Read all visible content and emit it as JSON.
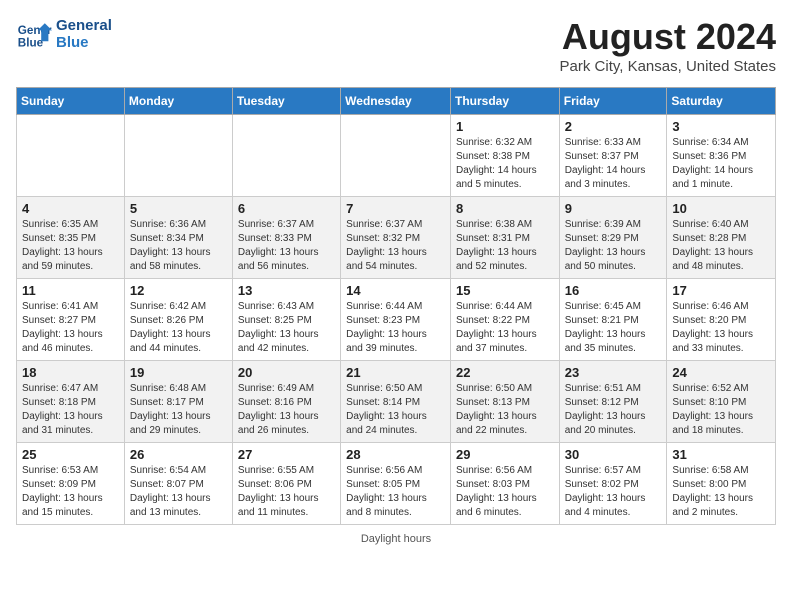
{
  "header": {
    "logo_line1": "General",
    "logo_line2": "Blue",
    "month_title": "August 2024",
    "location": "Park City, Kansas, United States"
  },
  "days_of_week": [
    "Sunday",
    "Monday",
    "Tuesday",
    "Wednesday",
    "Thursday",
    "Friday",
    "Saturday"
  ],
  "weeks": [
    [
      {
        "day": "",
        "sunrise": "",
        "sunset": "",
        "daylight": ""
      },
      {
        "day": "",
        "sunrise": "",
        "sunset": "",
        "daylight": ""
      },
      {
        "day": "",
        "sunrise": "",
        "sunset": "",
        "daylight": ""
      },
      {
        "day": "",
        "sunrise": "",
        "sunset": "",
        "daylight": ""
      },
      {
        "day": "1",
        "sunrise": "Sunrise: 6:32 AM",
        "sunset": "Sunset: 8:38 PM",
        "daylight": "Daylight: 14 hours and 5 minutes."
      },
      {
        "day": "2",
        "sunrise": "Sunrise: 6:33 AM",
        "sunset": "Sunset: 8:37 PM",
        "daylight": "Daylight: 14 hours and 3 minutes."
      },
      {
        "day": "3",
        "sunrise": "Sunrise: 6:34 AM",
        "sunset": "Sunset: 8:36 PM",
        "daylight": "Daylight: 14 hours and 1 minute."
      }
    ],
    [
      {
        "day": "4",
        "sunrise": "Sunrise: 6:35 AM",
        "sunset": "Sunset: 8:35 PM",
        "daylight": "Daylight: 13 hours and 59 minutes."
      },
      {
        "day": "5",
        "sunrise": "Sunrise: 6:36 AM",
        "sunset": "Sunset: 8:34 PM",
        "daylight": "Daylight: 13 hours and 58 minutes."
      },
      {
        "day": "6",
        "sunrise": "Sunrise: 6:37 AM",
        "sunset": "Sunset: 8:33 PM",
        "daylight": "Daylight: 13 hours and 56 minutes."
      },
      {
        "day": "7",
        "sunrise": "Sunrise: 6:37 AM",
        "sunset": "Sunset: 8:32 PM",
        "daylight": "Daylight: 13 hours and 54 minutes."
      },
      {
        "day": "8",
        "sunrise": "Sunrise: 6:38 AM",
        "sunset": "Sunset: 8:31 PM",
        "daylight": "Daylight: 13 hours and 52 minutes."
      },
      {
        "day": "9",
        "sunrise": "Sunrise: 6:39 AM",
        "sunset": "Sunset: 8:29 PM",
        "daylight": "Daylight: 13 hours and 50 minutes."
      },
      {
        "day": "10",
        "sunrise": "Sunrise: 6:40 AM",
        "sunset": "Sunset: 8:28 PM",
        "daylight": "Daylight: 13 hours and 48 minutes."
      }
    ],
    [
      {
        "day": "11",
        "sunrise": "Sunrise: 6:41 AM",
        "sunset": "Sunset: 8:27 PM",
        "daylight": "Daylight: 13 hours and 46 minutes."
      },
      {
        "day": "12",
        "sunrise": "Sunrise: 6:42 AM",
        "sunset": "Sunset: 8:26 PM",
        "daylight": "Daylight: 13 hours and 44 minutes."
      },
      {
        "day": "13",
        "sunrise": "Sunrise: 6:43 AM",
        "sunset": "Sunset: 8:25 PM",
        "daylight": "Daylight: 13 hours and 42 minutes."
      },
      {
        "day": "14",
        "sunrise": "Sunrise: 6:44 AM",
        "sunset": "Sunset: 8:23 PM",
        "daylight": "Daylight: 13 hours and 39 minutes."
      },
      {
        "day": "15",
        "sunrise": "Sunrise: 6:44 AM",
        "sunset": "Sunset: 8:22 PM",
        "daylight": "Daylight: 13 hours and 37 minutes."
      },
      {
        "day": "16",
        "sunrise": "Sunrise: 6:45 AM",
        "sunset": "Sunset: 8:21 PM",
        "daylight": "Daylight: 13 hours and 35 minutes."
      },
      {
        "day": "17",
        "sunrise": "Sunrise: 6:46 AM",
        "sunset": "Sunset: 8:20 PM",
        "daylight": "Daylight: 13 hours and 33 minutes."
      }
    ],
    [
      {
        "day": "18",
        "sunrise": "Sunrise: 6:47 AM",
        "sunset": "Sunset: 8:18 PM",
        "daylight": "Daylight: 13 hours and 31 minutes."
      },
      {
        "day": "19",
        "sunrise": "Sunrise: 6:48 AM",
        "sunset": "Sunset: 8:17 PM",
        "daylight": "Daylight: 13 hours and 29 minutes."
      },
      {
        "day": "20",
        "sunrise": "Sunrise: 6:49 AM",
        "sunset": "Sunset: 8:16 PM",
        "daylight": "Daylight: 13 hours and 26 minutes."
      },
      {
        "day": "21",
        "sunrise": "Sunrise: 6:50 AM",
        "sunset": "Sunset: 8:14 PM",
        "daylight": "Daylight: 13 hours and 24 minutes."
      },
      {
        "day": "22",
        "sunrise": "Sunrise: 6:50 AM",
        "sunset": "Sunset: 8:13 PM",
        "daylight": "Daylight: 13 hours and 22 minutes."
      },
      {
        "day": "23",
        "sunrise": "Sunrise: 6:51 AM",
        "sunset": "Sunset: 8:12 PM",
        "daylight": "Daylight: 13 hours and 20 minutes."
      },
      {
        "day": "24",
        "sunrise": "Sunrise: 6:52 AM",
        "sunset": "Sunset: 8:10 PM",
        "daylight": "Daylight: 13 hours and 18 minutes."
      }
    ],
    [
      {
        "day": "25",
        "sunrise": "Sunrise: 6:53 AM",
        "sunset": "Sunset: 8:09 PM",
        "daylight": "Daylight: 13 hours and 15 minutes."
      },
      {
        "day": "26",
        "sunrise": "Sunrise: 6:54 AM",
        "sunset": "Sunset: 8:07 PM",
        "daylight": "Daylight: 13 hours and 13 minutes."
      },
      {
        "day": "27",
        "sunrise": "Sunrise: 6:55 AM",
        "sunset": "Sunset: 8:06 PM",
        "daylight": "Daylight: 13 hours and 11 minutes."
      },
      {
        "day": "28",
        "sunrise": "Sunrise: 6:56 AM",
        "sunset": "Sunset: 8:05 PM",
        "daylight": "Daylight: 13 hours and 8 minutes."
      },
      {
        "day": "29",
        "sunrise": "Sunrise: 6:56 AM",
        "sunset": "Sunset: 8:03 PM",
        "daylight": "Daylight: 13 hours and 6 minutes."
      },
      {
        "day": "30",
        "sunrise": "Sunrise: 6:57 AM",
        "sunset": "Sunset: 8:02 PM",
        "daylight": "Daylight: 13 hours and 4 minutes."
      },
      {
        "day": "31",
        "sunrise": "Sunrise: 6:58 AM",
        "sunset": "Sunset: 8:00 PM",
        "daylight": "Daylight: 13 hours and 2 minutes."
      }
    ]
  ],
  "footer": "Daylight hours"
}
